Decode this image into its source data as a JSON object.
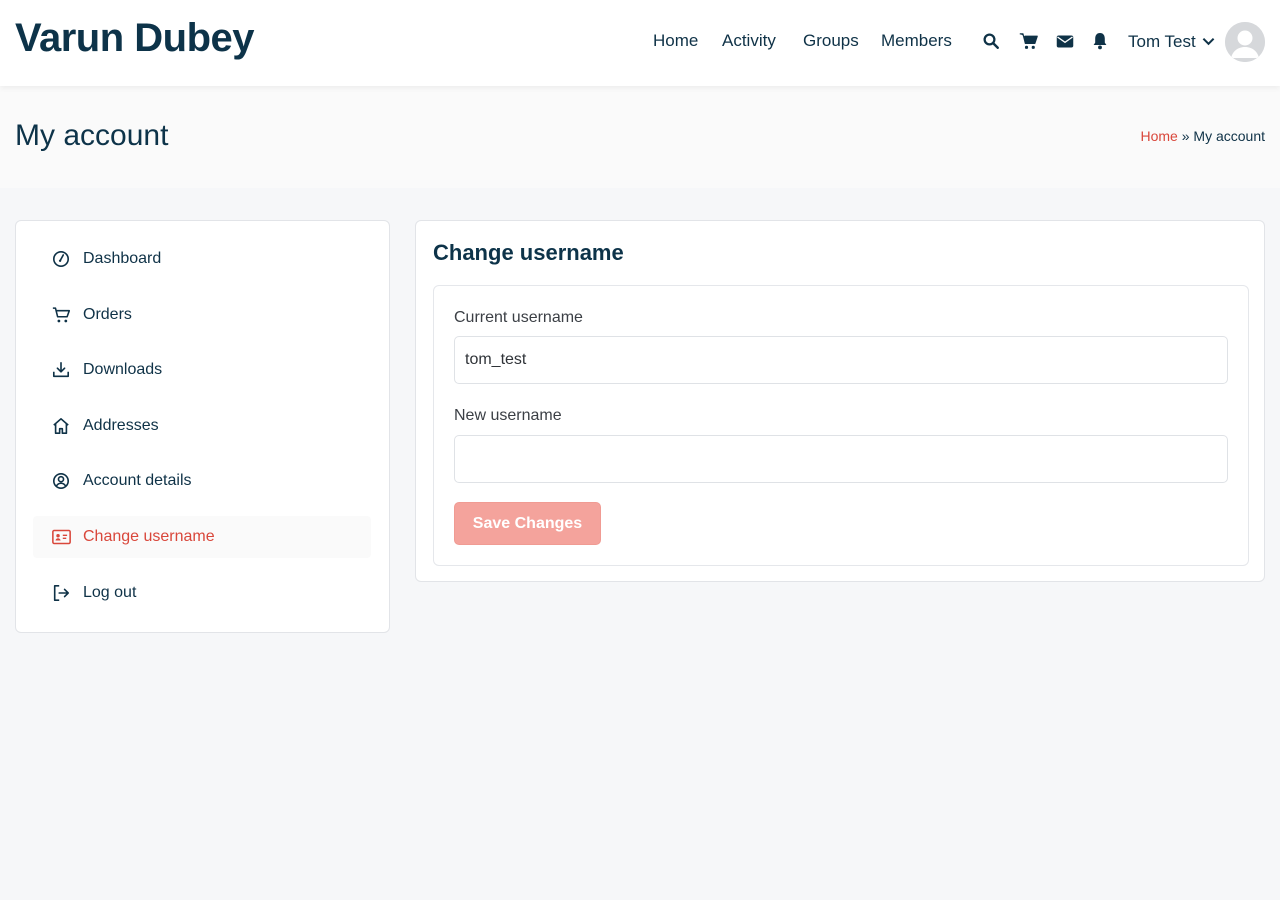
{
  "site": {
    "title": "Varun Dubey"
  },
  "nav": {
    "items": [
      {
        "label": "Home"
      },
      {
        "label": "Activity"
      },
      {
        "label": "Groups"
      },
      {
        "label": "Members"
      }
    ]
  },
  "header_icons": [
    "search-icon",
    "cart-icon",
    "mail-icon",
    "bell-icon"
  ],
  "user": {
    "name": "Tom Test"
  },
  "page": {
    "title": "My account"
  },
  "breadcrumb": {
    "home": "Home",
    "separator": "»",
    "current": "My account"
  },
  "sidebar": {
    "items": [
      {
        "label": "Dashboard",
        "icon": "dashboard-icon",
        "active": false
      },
      {
        "label": "Orders",
        "icon": "cart-icon",
        "active": false
      },
      {
        "label": "Downloads",
        "icon": "download-icon",
        "active": false
      },
      {
        "label": "Addresses",
        "icon": "home-icon",
        "active": false
      },
      {
        "label": "Account details",
        "icon": "user-circle-icon",
        "active": false
      },
      {
        "label": "Change username",
        "icon": "id-card-icon",
        "active": true
      },
      {
        "label": "Log out",
        "icon": "logout-icon",
        "active": false
      }
    ]
  },
  "form": {
    "title": "Change username",
    "current_label": "Current username",
    "current_value": "tom_test",
    "new_label": "New username",
    "new_value": "",
    "save_label": "Save Changes"
  },
  "colors": {
    "accent": "#d9473b",
    "text": "#0f3247",
    "button_disabled": "#f4a39c"
  }
}
